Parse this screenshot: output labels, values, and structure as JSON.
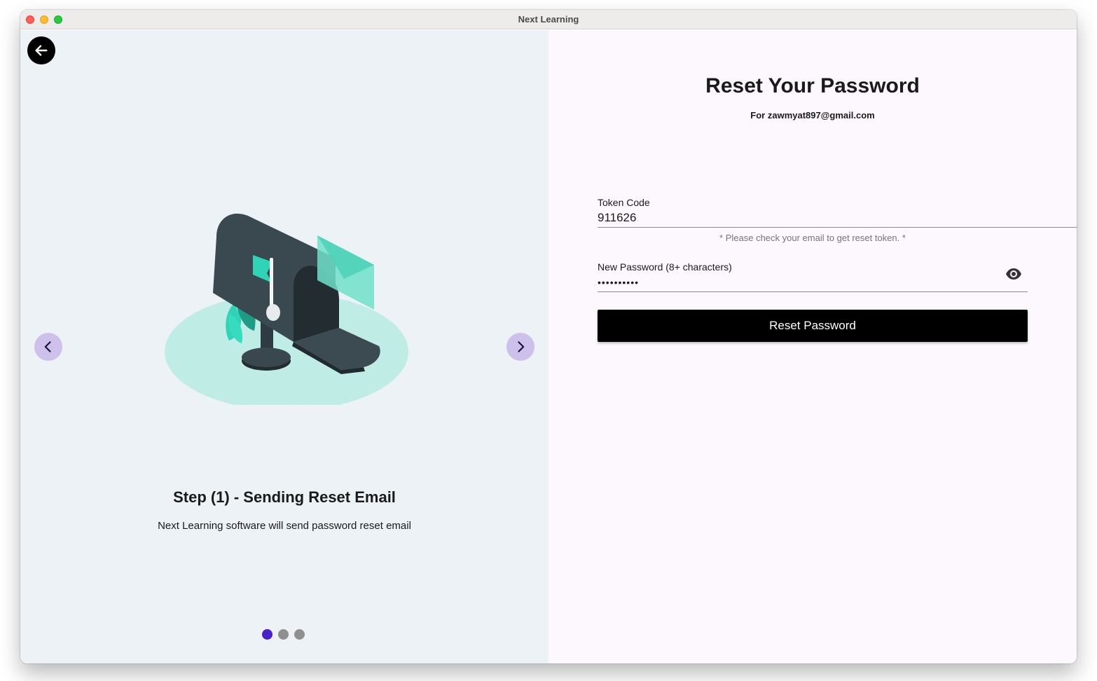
{
  "window": {
    "title": "Next Learning"
  },
  "carousel": {
    "step_title": "Step (1) - Sending Reset Email",
    "step_description": "Next Learning software will send password reset email",
    "slide_count": 3,
    "active_index": 0,
    "illustration": "mailbox-with-envelope",
    "colors": {
      "active_dot": "#4a20c8",
      "inactive_dot": "#8f8f8f",
      "nav_button": "#cdc1ec",
      "accent": "#2fd3b5"
    }
  },
  "form": {
    "heading": "Reset Your Password",
    "email_line": "For zawmyat897@gmail.com",
    "token_label": "Token Code",
    "token_value": "911626",
    "token_hint": "* Please check your email to get reset token. *",
    "password_label": "New Password (8+ characters)",
    "password_value": "••••••••••",
    "submit_label": "Reset Password"
  },
  "icons": {
    "back": "arrow-left-icon",
    "prev": "chevron-left-icon",
    "next": "chevron-right-icon",
    "visibility": "eye-icon"
  }
}
